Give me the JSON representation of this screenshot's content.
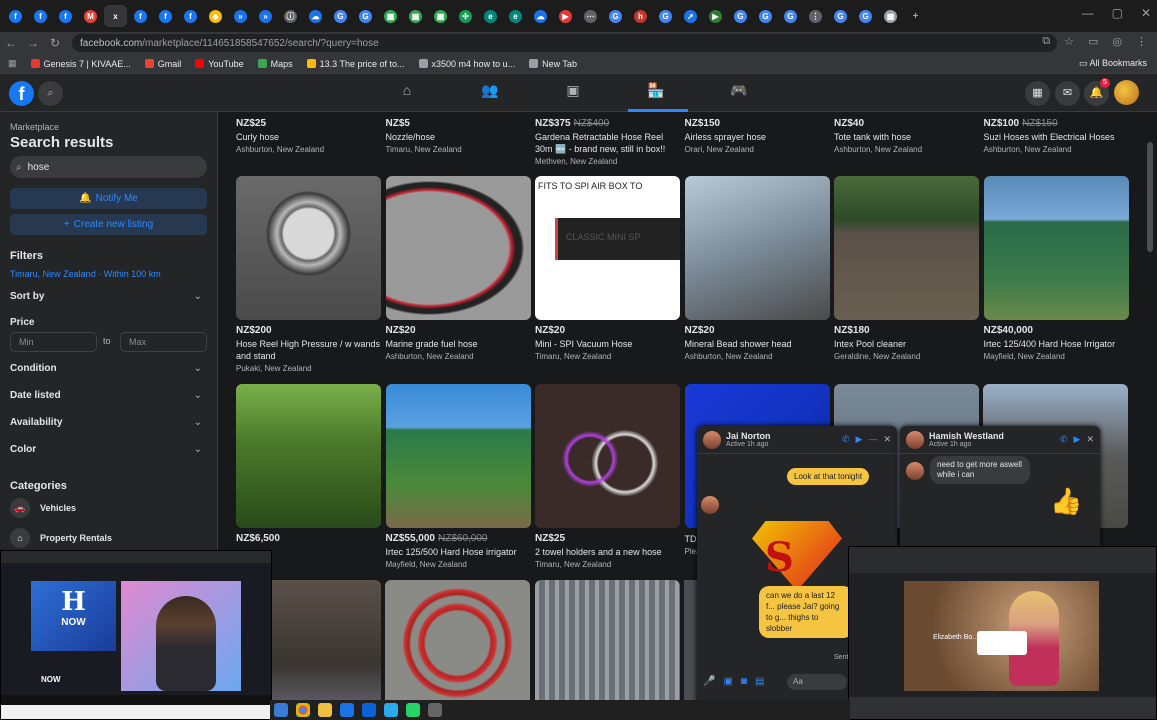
{
  "browser": {
    "tab_count_icons": [
      "f",
      "f",
      "f",
      "M",
      "x",
      "f",
      "f",
      "f",
      "◆",
      "»",
      "»",
      "ⓘ",
      "☁",
      "G",
      "G",
      "▦",
      "▦",
      "▦",
      "✣",
      "e",
      "e",
      "☁",
      "▶",
      "⋯",
      "G",
      "h",
      "G",
      "➚",
      "▶",
      "G",
      "G",
      "G",
      "⋮",
      "G",
      "G",
      "▦"
    ],
    "url_host": "facebook.com",
    "url_path": "/marketplace/114651858547652/search/?query=hose",
    "all_bookmarks": "All Bookmarks",
    "bookmarks": [
      {
        "label": "Genesis 7 | KIVAAE...",
        "color": "#e53935"
      },
      {
        "label": "Gmail",
        "color": "#ea4335"
      },
      {
        "label": "YouTube",
        "color": "#ff0000"
      },
      {
        "label": "Maps",
        "color": "#34a853"
      },
      {
        "label": "13.3 The price of to...",
        "color": "#fbbc04"
      },
      {
        "label": "x3500 m4 how to u...",
        "color": "#9aa0a6"
      },
      {
        "label": "New Tab",
        "color": "#9aa0a6"
      }
    ]
  },
  "fb": {
    "logo": "f",
    "notif_count": "5"
  },
  "sidebar": {
    "section": "Marketplace",
    "title": "Search results",
    "search_value": "hose",
    "notify_label": "Notify Me",
    "create_label": "Create new listing",
    "filters_heading": "Filters",
    "location": "Timaru, New Zealand · Within 100 km",
    "sort_by": "Sort by",
    "price_heading": "Price",
    "min_placeholder": "Min",
    "to": "to",
    "max_placeholder": "Max",
    "condition": "Condition",
    "date_listed": "Date listed",
    "availability": "Availability",
    "color": "Color",
    "categories_heading": "Categories",
    "cat_vehicles": "Vehicles",
    "cat_property": "Property Rentals"
  },
  "listings_row1": [
    {
      "price": "NZ$25",
      "old": "",
      "title": "Curly hose",
      "loc": "Ashburton, New Zealand"
    },
    {
      "price": "NZ$5",
      "old": "",
      "title": "Nozzle/hose",
      "loc": "Timaru, New Zealand"
    },
    {
      "price": "NZ$375",
      "old": "NZ$400",
      "title": "Gardena Retractable Hose Reel 30m 🆕 - brand new, still in box!!",
      "loc": "Methven, New Zealand"
    },
    {
      "price": "NZ$150",
      "old": "",
      "title": "Airless sprayer hose",
      "loc": "Orari, New Zealand"
    },
    {
      "price": "NZ$40",
      "old": "",
      "title": "Tote tank with hose",
      "loc": "Ashburton, New Zealand"
    },
    {
      "price": "NZ$100",
      "old": "NZ$150",
      "title": "Suzi Hoses with Electrical Hoses",
      "loc": "Ashburton, New Zealand"
    }
  ],
  "listings_row2": [
    {
      "price": "NZ$200",
      "title": "Hose Reel High Pressure / w wands and stand",
      "loc": "Pukaki, New Zealand"
    },
    {
      "price": "NZ$20",
      "title": "Marine grade fuel hose",
      "loc": "Ashburton, New Zealand"
    },
    {
      "price": "NZ$20",
      "title": "Mini - SPI Vacuum Hose",
      "loc": "Timaru, New Zealand"
    },
    {
      "price": "NZ$20",
      "title": "Mineral Bead shower head",
      "loc": "Ashburton, New Zealand"
    },
    {
      "price": "NZ$180",
      "title": "Intex Pool cleaner",
      "loc": "Geraldine, New Zealand"
    },
    {
      "price": "NZ$40,000",
      "title": "Irtec 125/400 Hard Hose Irrigator",
      "loc": "Mayfield, New Zealand"
    }
  ],
  "listings_row3": [
    {
      "price": "NZ$6,500",
      "old": "",
      "title": "",
      "loc": ""
    },
    {
      "price": "NZ$55,000",
      "old": "NZ$60,000",
      "title": "Irtec 125/500 Hard Hose irrigator",
      "loc": "Mayfield, New Zealand"
    },
    {
      "price": "NZ$25",
      "old": "",
      "title": "2 towel holders and a new hose",
      "loc": "Timaru, New Zealand"
    },
    {
      "price": "",
      "old": "",
      "title": "TD5",
      "loc": "Plea"
    }
  ],
  "thumb2_text": "FITS TO SPI AIR BOX TO",
  "thumb2_sub": "CLASSIC MINI SP",
  "chat1": {
    "name": "Jai Norton",
    "status": "Active 1h ago",
    "msg1": "Look at that tonight",
    "msg2": "can we do a last 12 f... please Jai? going to g... thighs to slobber",
    "compose": "Aa",
    "sent": "Sent"
  },
  "chat2": {
    "name": "Hamish Westland",
    "status": "Active 1h ago",
    "msg": "need to get more aswell while i can"
  },
  "overlay_left": {
    "logo": "NOW",
    "caption": "NOW"
  },
  "overlay_right": {
    "name": "Elizabeth Bo..."
  }
}
